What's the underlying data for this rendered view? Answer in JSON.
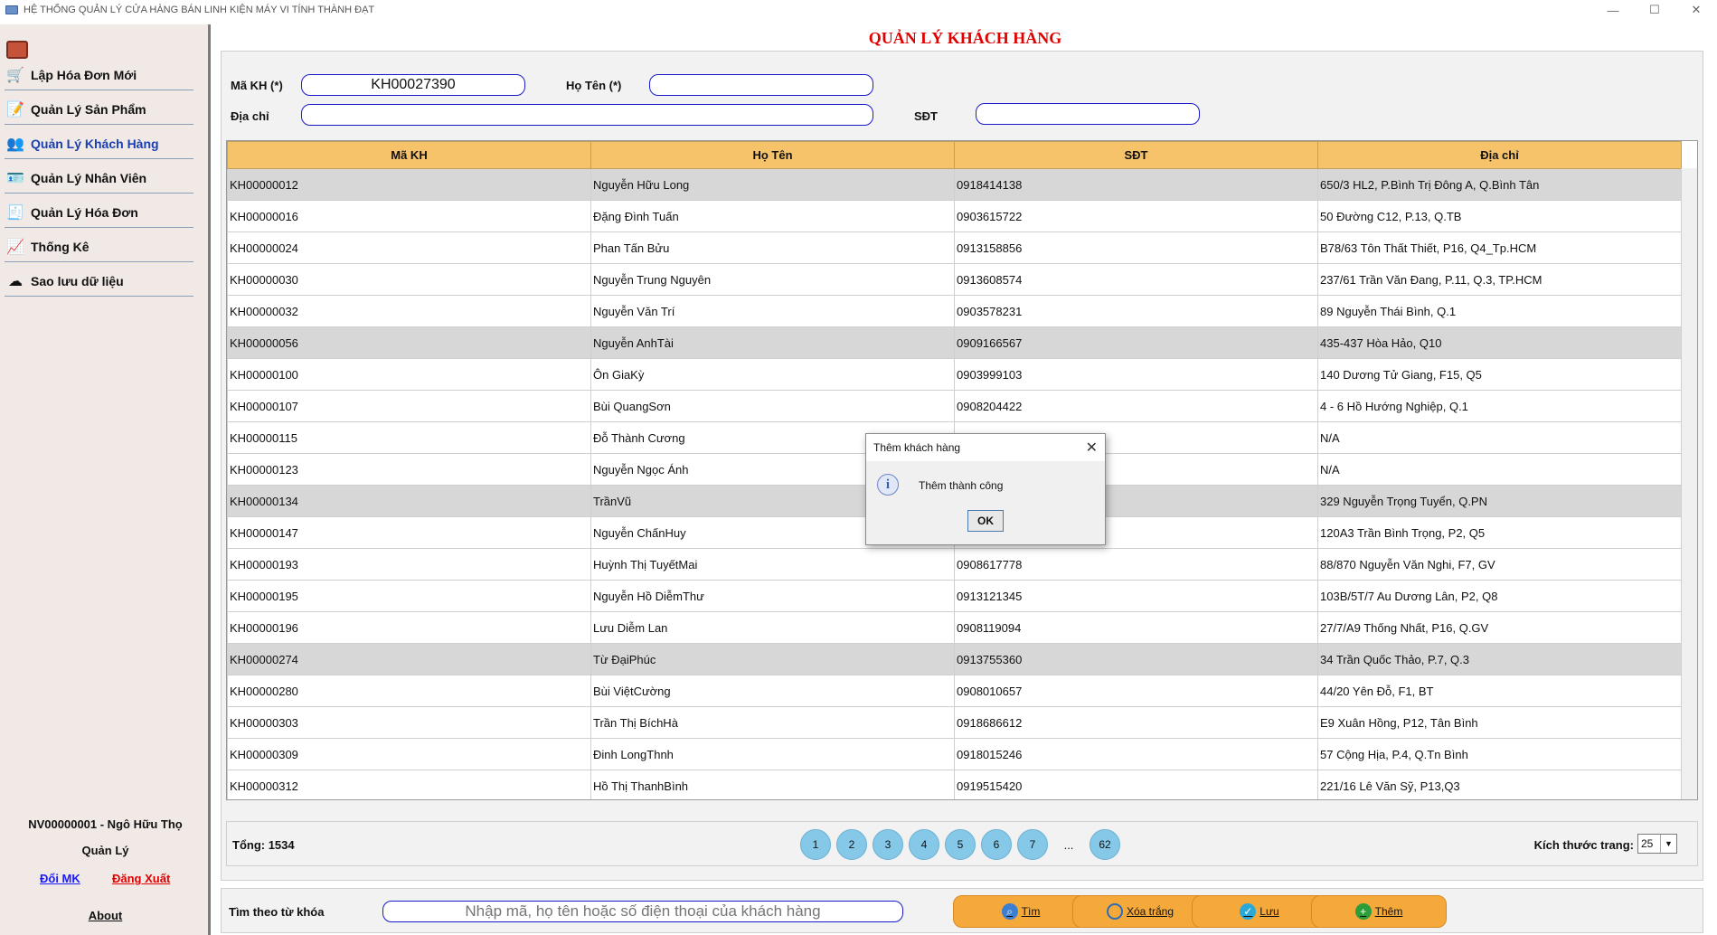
{
  "window": {
    "title": "HỆ THỐNG QUẢN LÝ CỬA HÀNG BÁN LINH KIỆN MÁY VI TÍNH THÀNH ĐẠT",
    "minimize": "—",
    "maximize": "☐",
    "close": "✕"
  },
  "sidebar": {
    "items": [
      {
        "label": "Lập Hóa Đơn Mới",
        "icon": "cart-add-icon",
        "glyph": "🛒"
      },
      {
        "label": "Quản Lý Sản Phẩm",
        "icon": "edit-document-icon",
        "glyph": "📝"
      },
      {
        "label": "Quản Lý Khách Hàng",
        "icon": "customers-icon",
        "glyph": "👥"
      },
      {
        "label": "Quản Lý Nhân Viên",
        "icon": "employee-card-icon",
        "glyph": "🪪"
      },
      {
        "label": "Quản Lý Hóa Đơn",
        "icon": "invoice-icon",
        "glyph": "🧾"
      },
      {
        "label": "Thống Kê",
        "icon": "chart-icon",
        "glyph": "📈"
      },
      {
        "label": "Sao lưu dữ liệu",
        "icon": "cloud-backup-icon",
        "glyph": "☁"
      }
    ],
    "user": "NV00000001 - Ngô Hữu  Thọ",
    "role": "Quản Lý",
    "change_password": "Đổi MK",
    "logout": "Đăng Xuất",
    "about": "About"
  },
  "page": {
    "title": "QUẢN LÝ KHÁCH HÀNG"
  },
  "form": {
    "ma_kh_label": "Mã KH (*)",
    "ma_kh_value": "KH00027390",
    "ho_ten_label": "Họ Tên (*)",
    "ho_ten_value": "",
    "dia_chi_label": "Địa chỉ",
    "dia_chi_value": "",
    "sdt_label": "SĐT",
    "sdt_value": ""
  },
  "table": {
    "columns": [
      "Mã KH",
      "Họ Tên",
      "SĐT",
      "Địa chỉ"
    ],
    "rows": [
      [
        "KH00000012",
        "Nguyễn Hữu Long",
        "0918414138",
        "650/3 HL2, P.Bình Trị Đông A, Q.Bình Tân"
      ],
      [
        "KH00000016",
        "Đặng Đình Tuấn",
        "0903615722",
        "50 Đường C12, P.13, Q.TB"
      ],
      [
        "KH00000024",
        "Phan Tấn Bửu",
        "0913158856",
        "B78/63 Tôn Thất Thiết, P16, Q4_Tp.HCM"
      ],
      [
        "KH00000030",
        "Nguyễn Trung Nguyên",
        "0913608574",
        "237/61 Trần Văn Đang, P.11, Q.3, TP.HCM"
      ],
      [
        "KH00000032",
        "Nguyễn Văn Trí",
        "0903578231",
        "89 Nguyễn Thái Bình, Q.1"
      ],
      [
        "KH00000056",
        "Nguyễn AnhTài",
        "0909166567",
        "435-437 Hòa Hảo, Q10"
      ],
      [
        "KH00000100",
        "Ôn GiaKỳ",
        "0903999103",
        "140 Dương Tử Giang, F15, Q5"
      ],
      [
        "KH00000107",
        "Bùi QuangSơn",
        "0908204422",
        "4 - 6 Hồ Hướng Nghiệp, Q.1"
      ],
      [
        "KH00000115",
        "Đỗ Thành Cương",
        "",
        "N/A"
      ],
      [
        "KH00000123",
        "Nguyễn Ngọc Ánh",
        "",
        "N/A"
      ],
      [
        "KH00000134",
        "TrầnVũ",
        "",
        "329 Nguyễn Trọng Tuyển, Q.PN"
      ],
      [
        "KH00000147",
        "Nguyễn ChấnHuy",
        "",
        "120A3 Trần Bình Trọng, P2, Q5"
      ],
      [
        "KH00000193",
        "Huỳnh Thị TuyếtMai",
        "0908617778",
        "88/870 Nguyễn Văn Nghi, F7, GV"
      ],
      [
        "KH00000195",
        "Nguyễn Hồ DiễmThư",
        "0913121345",
        "103B/5T/7 Au Dương Lân, P2, Q8"
      ],
      [
        "KH00000196",
        "Lưu Diễm Lan",
        "0908119094",
        "27/7/A9 Thống Nhất, P16, Q.GV"
      ],
      [
        "KH00000274",
        "Từ ĐạiPhúc",
        "0913755360",
        "34 Trần Quốc Thảo, P.7, Q.3"
      ],
      [
        "KH00000280",
        "Bùi ViệtCường",
        "0908010657",
        "44/20 Yên Đỗ, F1, BT"
      ],
      [
        "KH00000303",
        "Trần Thị BíchHà",
        "0918686612",
        "E9 Xuân Hồng, P12, Tân Bình"
      ],
      [
        "KH00000309",
        "Đinh LongThnh",
        "0918015246",
        "57 Cộng Hịa, P.4, Q.Tn Bình"
      ],
      [
        "KH00000312",
        "Hồ Thị ThanhBình",
        "0919515420",
        "221/16 Lê Văn Sỹ, P13,Q3"
      ]
    ],
    "shaded_rows": [
      0,
      5,
      10,
      15
    ]
  },
  "pagination": {
    "total": "Tổng: 1534",
    "pages": [
      "1",
      "2",
      "3",
      "4",
      "5",
      "6",
      "7"
    ],
    "ellipsis": "...",
    "last": "62",
    "size_label": "Kích thước trang:",
    "size_value": "25"
  },
  "search": {
    "label": "Tìm theo từ khóa",
    "placeholder": "Nhập mã, họ tên hoặc số điện thoại của khách hàng"
  },
  "actions": {
    "find": "Tìm",
    "clear": "Xóa trắng",
    "save": "Lưu",
    "add": "Thêm"
  },
  "dialog": {
    "title": "Thêm khách hàng",
    "message": "Thêm thành công",
    "ok": "OK",
    "close_glyph": "✕",
    "info_glyph": "i"
  },
  "colors": {
    "title_red": "#e00000",
    "table_header": "#f6c36a",
    "button_orange": "#f5a93a",
    "page_button": "#85c8e8"
  }
}
